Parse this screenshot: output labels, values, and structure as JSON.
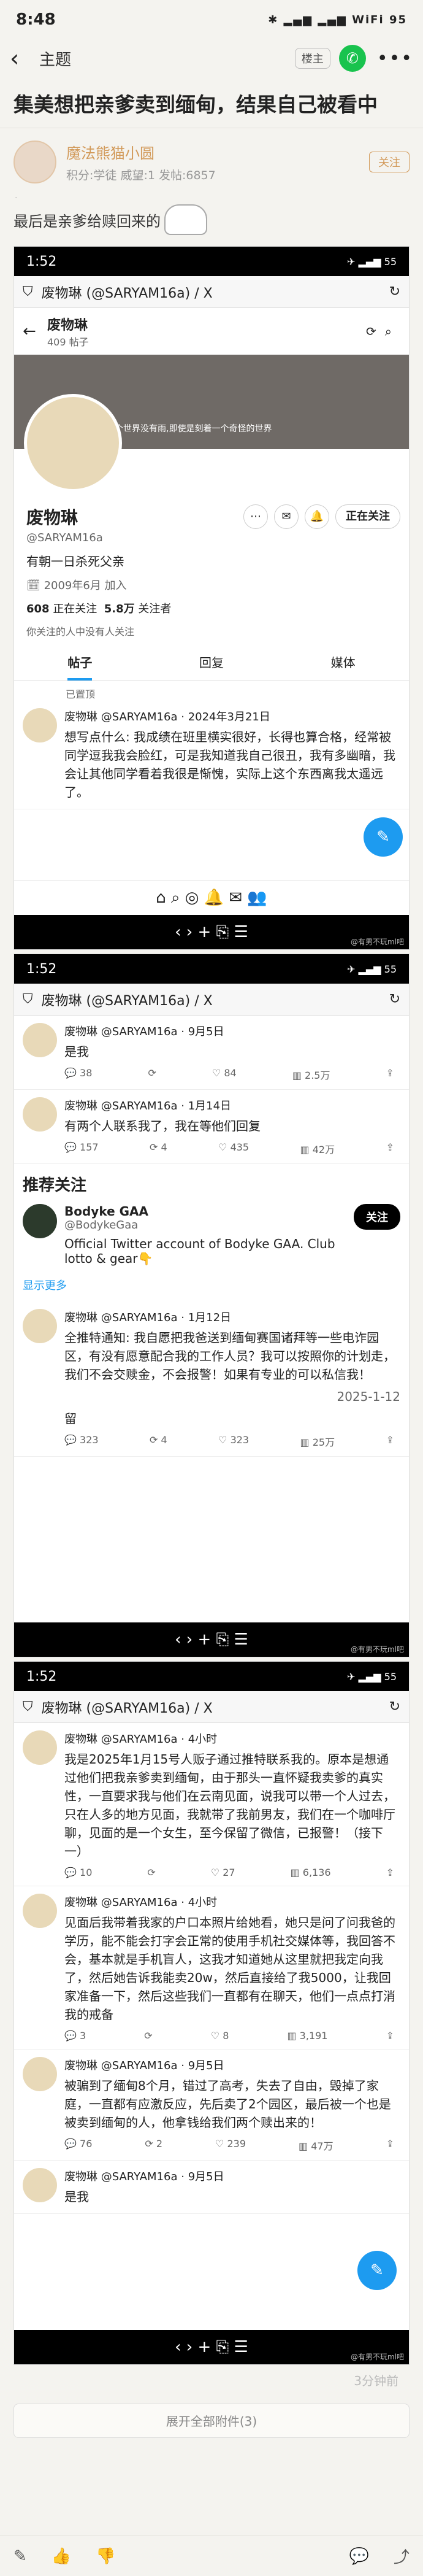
{
  "status": {
    "time": "8:48",
    "icons": "✱ ▂▄▆ ▂▄▆ WiFi",
    "battery": "95"
  },
  "nav": {
    "back": "‹",
    "title": "主题",
    "pill": "楼主",
    "wechat": "✆",
    "more": "•••"
  },
  "post": {
    "title": "集美想把亲爹卖到缅甸，结果自己被看中",
    "author_name": "魔法熊猫小圆",
    "author_meta": "积分:学徒 威望:1 发帖:6857",
    "author_dot": "·",
    "follow": "关注",
    "body": "最后是亲爹给赎回来的"
  },
  "shot1": {
    "time": "1:52",
    "status_right": "✈ ▂▄▆ 55",
    "browser_title": "废物琳 (@SARYAM16a) / X",
    "header_name": "废物琳",
    "header_count": "409 帖子",
    "banner_caption": "这个世界没有雨,即使是刻着一个奇怪的世界",
    "display_name": "废物琳",
    "handle": "@SARYAM16a",
    "bio": "有朝一日杀死父亲",
    "joined": "2009年6月 加入",
    "following_num": "608",
    "following_label": "正在关注",
    "followers_num": "5.8万",
    "followers_label": "关注者",
    "note": "你关注的人中没有人关注",
    "follow_btn": "正在关注",
    "tabs": [
      "帖子",
      "回复",
      "媒体"
    ],
    "pinned": "已置顶",
    "tweet_head": "废物琳 @SARYAM16a · 2024年3月21日",
    "tweet_text": "想写点什么: 我成绩在班里横实很好，长得也算合格，经常被同学逗我我会脸红，可是我知道我自己很丑，我有多幽暗，我会让其他同学看着我很是惭愧，实际上这个东西离我太遥远了。"
  },
  "shot2": {
    "tweets": [
      {
        "head": "废物琳 @SARYAM16a · 9月5日",
        "text": "是我",
        "replies": "38",
        "rts": "",
        "likes": "84",
        "views": "2.5万"
      },
      {
        "head": "废物琳 @SARYAM16a · 1月14日",
        "text": "有两个人联系我了，我在等他们回复",
        "replies": "157",
        "rts": "4",
        "likes": "435",
        "views": "42万"
      }
    ],
    "reco_title": "推荐关注",
    "reco_name": "Bodyke GAA",
    "reco_handle": "@BodykeGaa",
    "reco_desc": "Official Twitter account of Bodyke GAA. Club lotto & gear👇",
    "reco_follow": "关注",
    "reco_more": "显示更多",
    "notice_head": "废物琳 @SARYAM16a · 1月12日",
    "notice_text": "全推特通知: 我自愿把我爸送到缅甸赛国诸拜等一些电诈园区，有没有愿意配合我的工作人员？我可以按照你的计划走，我们不会交赎金，不会报警！如果有专业的可以私信我！",
    "notice_date": "2025-1-12",
    "notice_tail": "留",
    "stats": {
      "replies": "323",
      "rts": "4",
      "likes": "323",
      "views": "25万"
    }
  },
  "shot3": {
    "tweets": [
      {
        "head": "废物琳 @SARYAM16a · 4小时",
        "text": "我是2025年1月15号人贩子通过推特联系我的。原本是想通过他们把我亲爹卖到缅甸，由于那头一直怀疑我卖爹的真实性，一直要求我与他们在云南见面，说我可以带一个人过去，只在人多的地方见面，我就带了我前男友，我们在一个咖啡厅聊，见面的是一个女生，至今保留了微信，已报警！（接下一）",
        "replies": "10",
        "rts": "",
        "likes": "27",
        "views": "6,136"
      },
      {
        "head": "废物琳 @SARYAM16a · 4小时",
        "text": "见面后我带着我家的户口本照片给她看，她只是问了问我爸的学历，能不能会打字会正常的使用手机社交媒体等，我回答不会，基本就是手机盲人，这我才知道她从这里就把我定向我了，然后她告诉我能卖20w，然后直接给了我5000，让我回家准备一下，然后这些我们一直都有在聊天，他们一点点打消我的戒备",
        "replies": "3",
        "rts": "",
        "likes": "8",
        "views": "3,191"
      },
      {
        "head": "废物琳 @SARYAM16a · 9月5日",
        "text": "被骗到了缅甸8个月，错过了高考，失去了自由，毁掉了家庭，一直都有应激反应，先后卖了2个园区，最后被一个也是被卖到缅甸的人，他拿钱给我们两个赎出来的！",
        "replies": "76",
        "rts": "2",
        "likes": "239",
        "views": "47万"
      },
      {
        "head": "废物琳 @SARYAM16a · 9月5日",
        "text": "是我",
        "replies": "",
        "rts": "",
        "likes": "",
        "views": ""
      }
    ]
  },
  "watermark": "@有男不玩ml吧",
  "time_ago": "3分钟前",
  "expand": "展开全部附件(3)",
  "bottom": {
    "reply": "✎",
    "like": "👍",
    "dislike": "👎",
    "comment": "💬",
    "share": "⤴"
  }
}
